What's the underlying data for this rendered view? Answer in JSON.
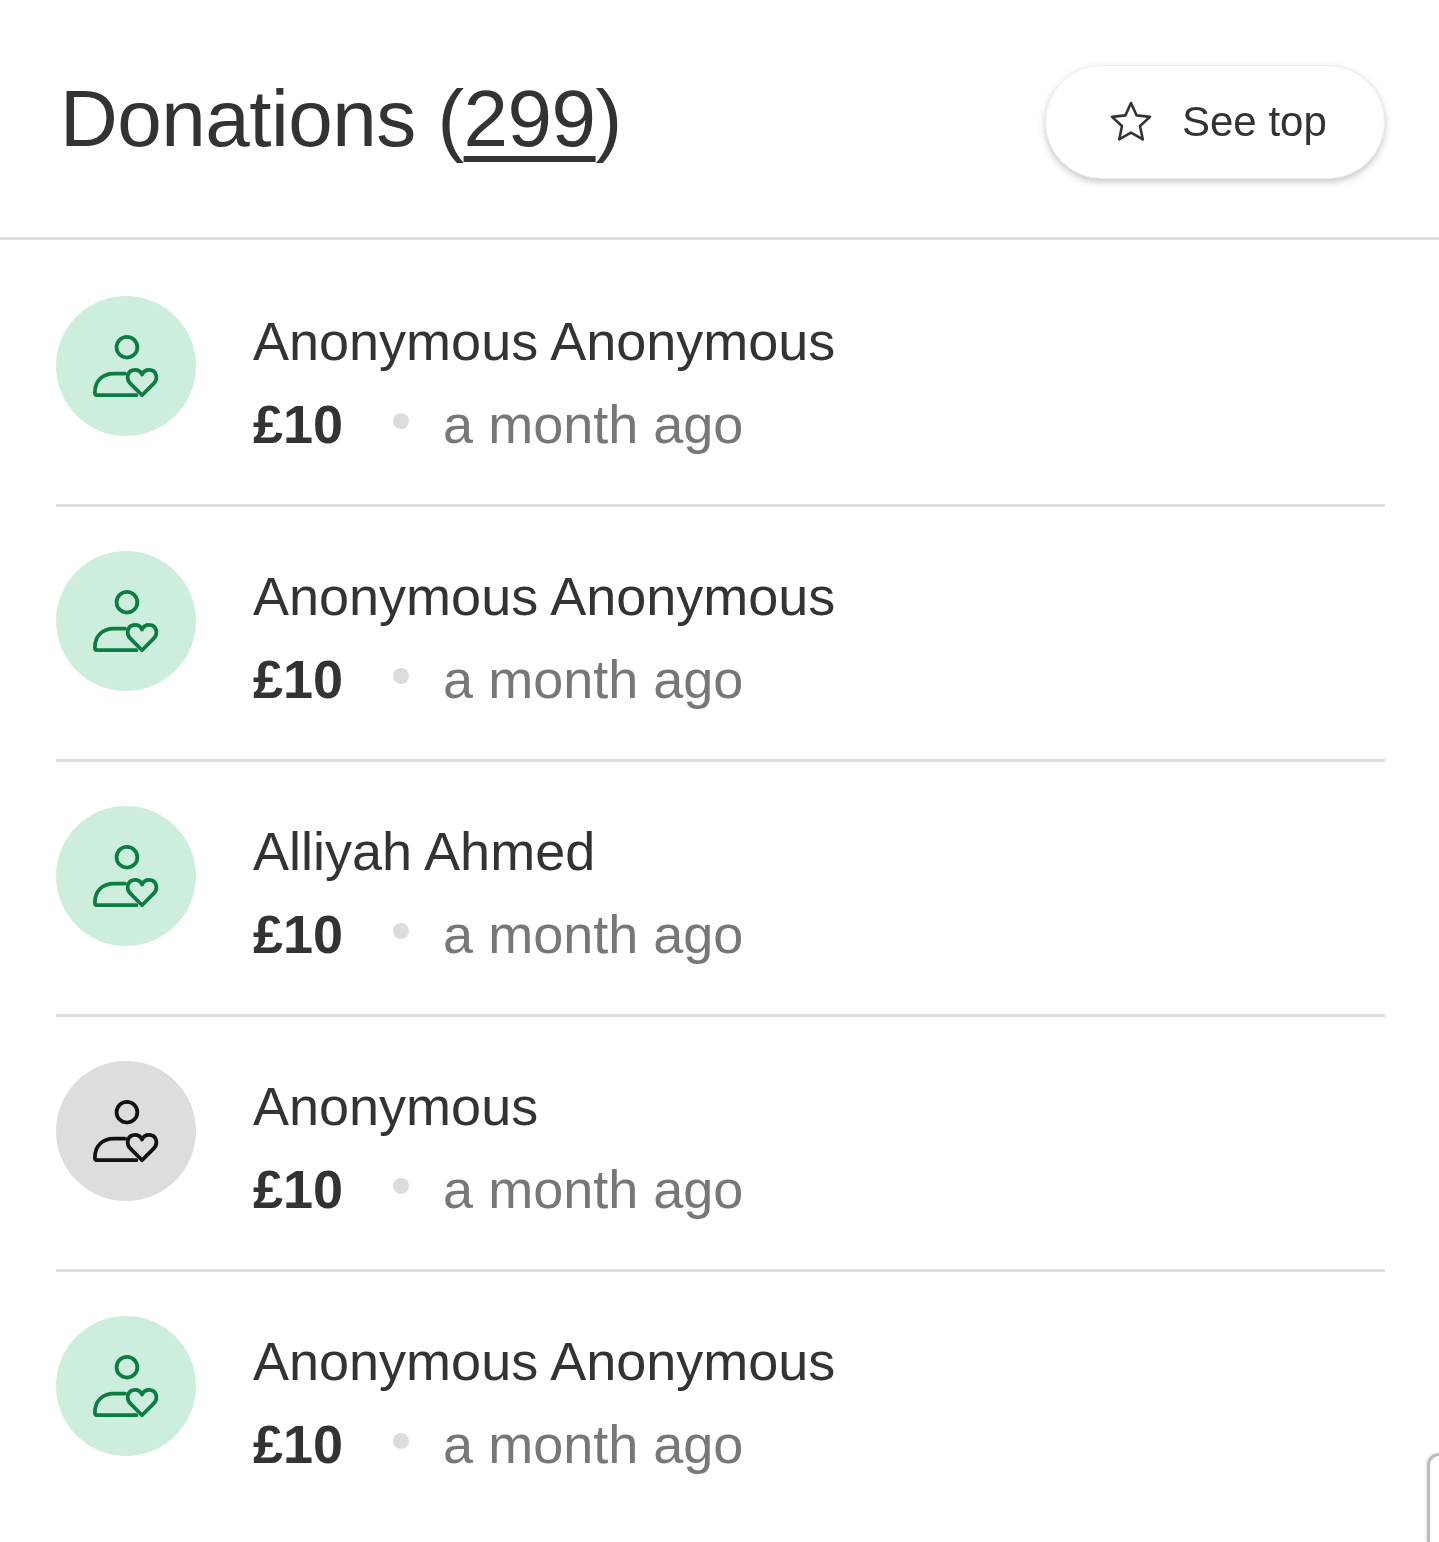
{
  "header": {
    "title_parts": [
      {
        "text": "Donations (",
        "link": false
      },
      {
        "text": "299",
        "link": true
      },
      {
        "text": ")",
        "link": false
      }
    ],
    "see_top_button": {
      "label": "See top"
    }
  },
  "donations": [
    {
      "name": "Anonymous Anonymous",
      "amount": "£10",
      "time": "a month ago",
      "kind": "accent"
    },
    {
      "name": "Anonymous Anonymous",
      "amount": "£10",
      "time": "a month ago",
      "kind": "accent"
    },
    {
      "name": "Alliyah Ahmed",
      "amount": "£10",
      "time": "a month ago",
      "kind": "accent"
    },
    {
      "name": "Anonymous",
      "amount": "£10",
      "time": "a month ago",
      "kind": "neutral"
    },
    {
      "name": "Anonymous Anonymous",
      "amount": "£10",
      "time": "a month ago",
      "kind": "accent"
    }
  ]
}
